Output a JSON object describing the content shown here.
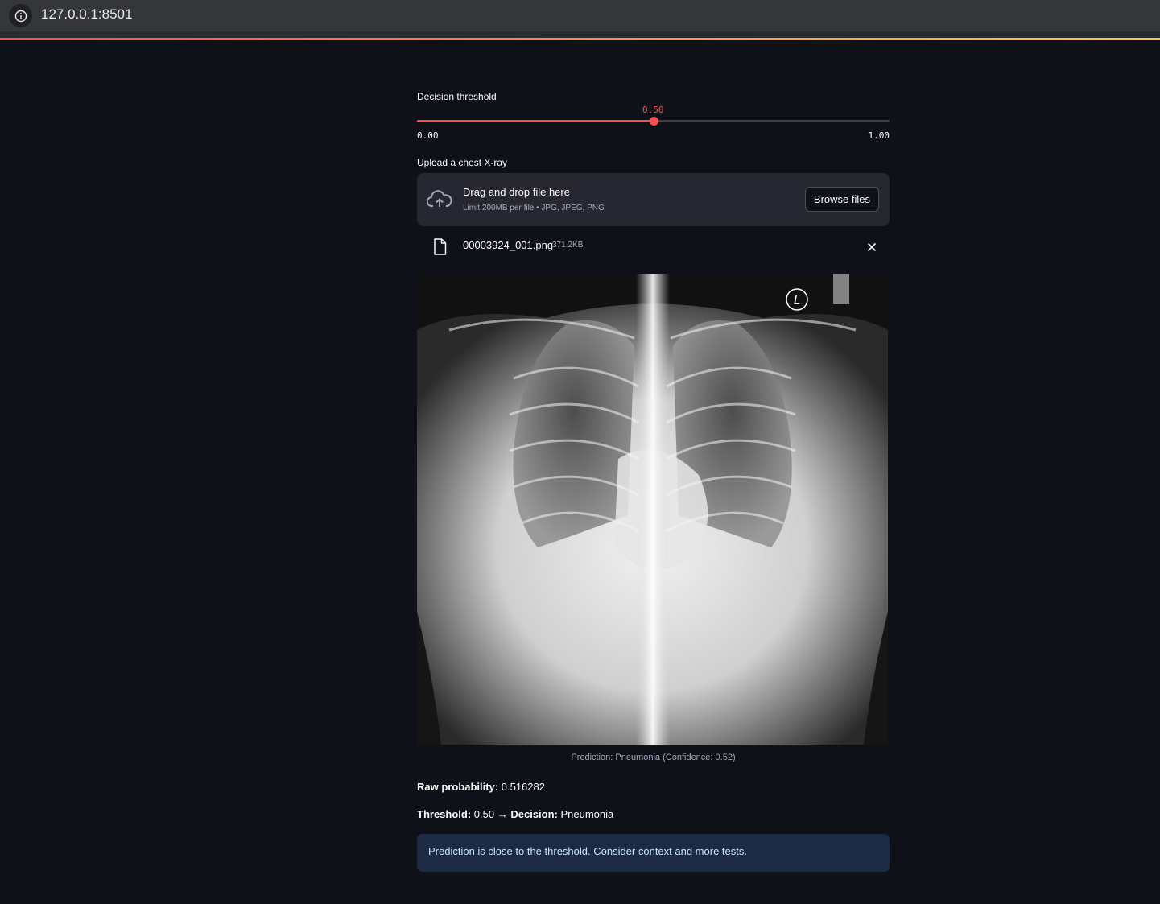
{
  "browser": {
    "url": "127.0.0.1:8501"
  },
  "slider": {
    "label": "Decision threshold",
    "value": 0.5,
    "value_text": "0.50",
    "min_text": "0.00",
    "max_text": "1.00"
  },
  "uploader": {
    "label": "Upload a chest X-ray",
    "drop_text": "Drag and drop file here",
    "limit_text": "Limit 200MB per file • JPG, JPEG, PNG",
    "browse_label": "Browse files",
    "file_name": "00003924_001.png",
    "file_size": "371.2KB"
  },
  "image": {
    "caption": "Prediction: Pneumonia (Confidence: 0.52)",
    "marker": "L"
  },
  "results": {
    "raw_prob_label": "Raw probability:",
    "raw_prob_value": "0.516282",
    "threshold_label": "Threshold:",
    "threshold_value": "0.50 →",
    "decision_label": "Decision:",
    "decision_value": "Pneumonia"
  },
  "info": {
    "message": "Prediction is close to the threshold. Consider context and more tests."
  },
  "colors": {
    "accent": "#ff4b4b",
    "background": "#0e1117",
    "info_bg": "#1c2a44"
  }
}
